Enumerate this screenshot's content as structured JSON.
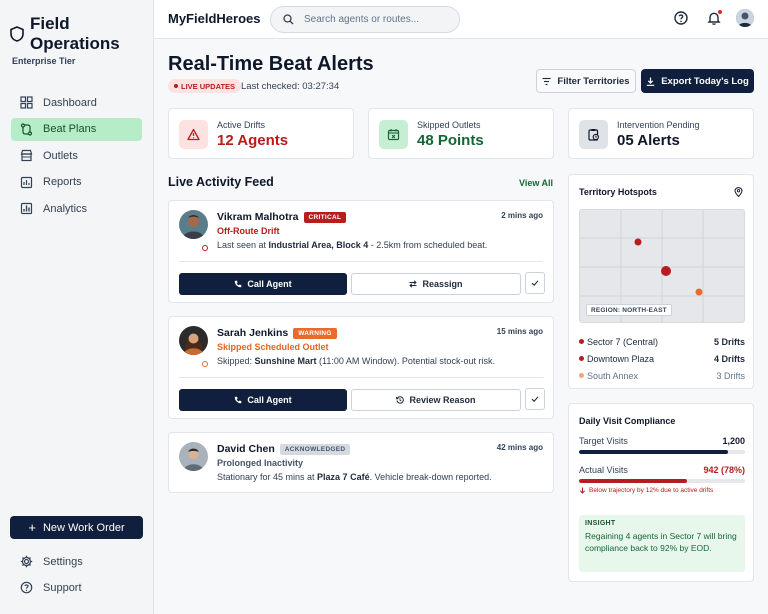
{
  "sidebar": {
    "brand": "Field Operations",
    "tier": "Enterprise Tier",
    "items": [
      {
        "label": "Dashboard",
        "icon": "dashboard-icon"
      },
      {
        "label": "Beat Plans",
        "icon": "route-icon",
        "active": true
      },
      {
        "label": "Outlets",
        "icon": "store-icon"
      },
      {
        "label": "Reports",
        "icon": "reports-icon"
      },
      {
        "label": "Analytics",
        "icon": "analytics-icon"
      }
    ],
    "new_work_order": "New Work Order",
    "footer_items": [
      {
        "label": "Settings",
        "icon": "gear-icon"
      },
      {
        "label": "Support",
        "icon": "help-icon"
      }
    ]
  },
  "topbar": {
    "app_name": "MyFieldHeroes",
    "search_placeholder": "Search agents or routes..."
  },
  "header": {
    "title": "Real-Time Beat Alerts",
    "live_badge": "LIVE UPDATES",
    "last_checked": "Last checked: 03:27:34",
    "filter_button": "Filter Territories",
    "export_button": "Export Today's Log"
  },
  "stats": [
    {
      "label": "Active Drifts",
      "value": "12 Agents",
      "color": "#b91c1c",
      "icon": "warning-icon"
    },
    {
      "label": "Skipped Outlets",
      "value": "48 Points",
      "color": "#166534",
      "icon": "calendar-x-icon"
    },
    {
      "label": "Intervention Pending",
      "value": "05 Alerts",
      "color": "#0f172a",
      "icon": "clipboard-clock-icon"
    }
  ],
  "feed": {
    "title": "Live Activity Feed",
    "view_all": "View All",
    "alerts": [
      {
        "name": "Vikram Malhotra",
        "tag": "CRITICAL",
        "tag_color": "#b91c1c",
        "time": "2 mins ago",
        "type": "Off-Route Drift",
        "type_color": "#b91c1c",
        "desc_pre": "Last seen at ",
        "desc_bold": "Industrial Area, Block 4",
        "desc_post": " - 2.5km from scheduled beat.",
        "primary_action": "Call Agent",
        "secondary_action": "Reassign"
      },
      {
        "name": "Sarah Jenkins",
        "tag": "WARNING",
        "tag_color": "#ea6a2c",
        "time": "15 mins ago",
        "type": "Skipped Scheduled Outlet",
        "type_color": "#e2651f",
        "desc_pre": "Skipped: ",
        "desc_bold": "Sunshine Mart",
        "desc_post": " (11:00 AM Window). Potential stock-out risk.",
        "primary_action": "Call Agent",
        "secondary_action": "Review Reason"
      },
      {
        "name": "David Chen",
        "tag": "ACKNOWLEDGED",
        "tag_color": "#cbd2dc",
        "time": "42 mins ago",
        "type": "Prolonged Inactivity",
        "type_color": "#475569",
        "desc_pre": "Stationary for 45 mins at ",
        "desc_bold": "Plaza 7 Café",
        "desc_post": ". Vehicle break-down reported."
      }
    ]
  },
  "hotspots": {
    "title": "Territory Hotspots",
    "region": "REGION: NORTH-EAST",
    "items": [
      {
        "name": "Sector 7 (Central)",
        "value": "5 Drifts",
        "color": "#b91c1c"
      },
      {
        "name": "Downtown Plaza",
        "value": "4 Drifts",
        "color": "#b91c1c"
      },
      {
        "name": "South Annex",
        "value": "3 Drifts",
        "color": "#f4a27c",
        "muted": true
      }
    ]
  },
  "compliance": {
    "title": "Daily Visit Compliance",
    "target_label": "Target Visits",
    "target_value": "1,200",
    "target_fill": 0.9,
    "actual_label": "Actual Visits",
    "actual_value": "942 (78%)",
    "actual_fill": 0.65,
    "note": "Below trajectory by 12% due to active drifts",
    "insight_title": "INSIGHT",
    "insight_body": "Regaining 4 agents in Sector 7 will bring compliance back to 92% by EOD."
  }
}
